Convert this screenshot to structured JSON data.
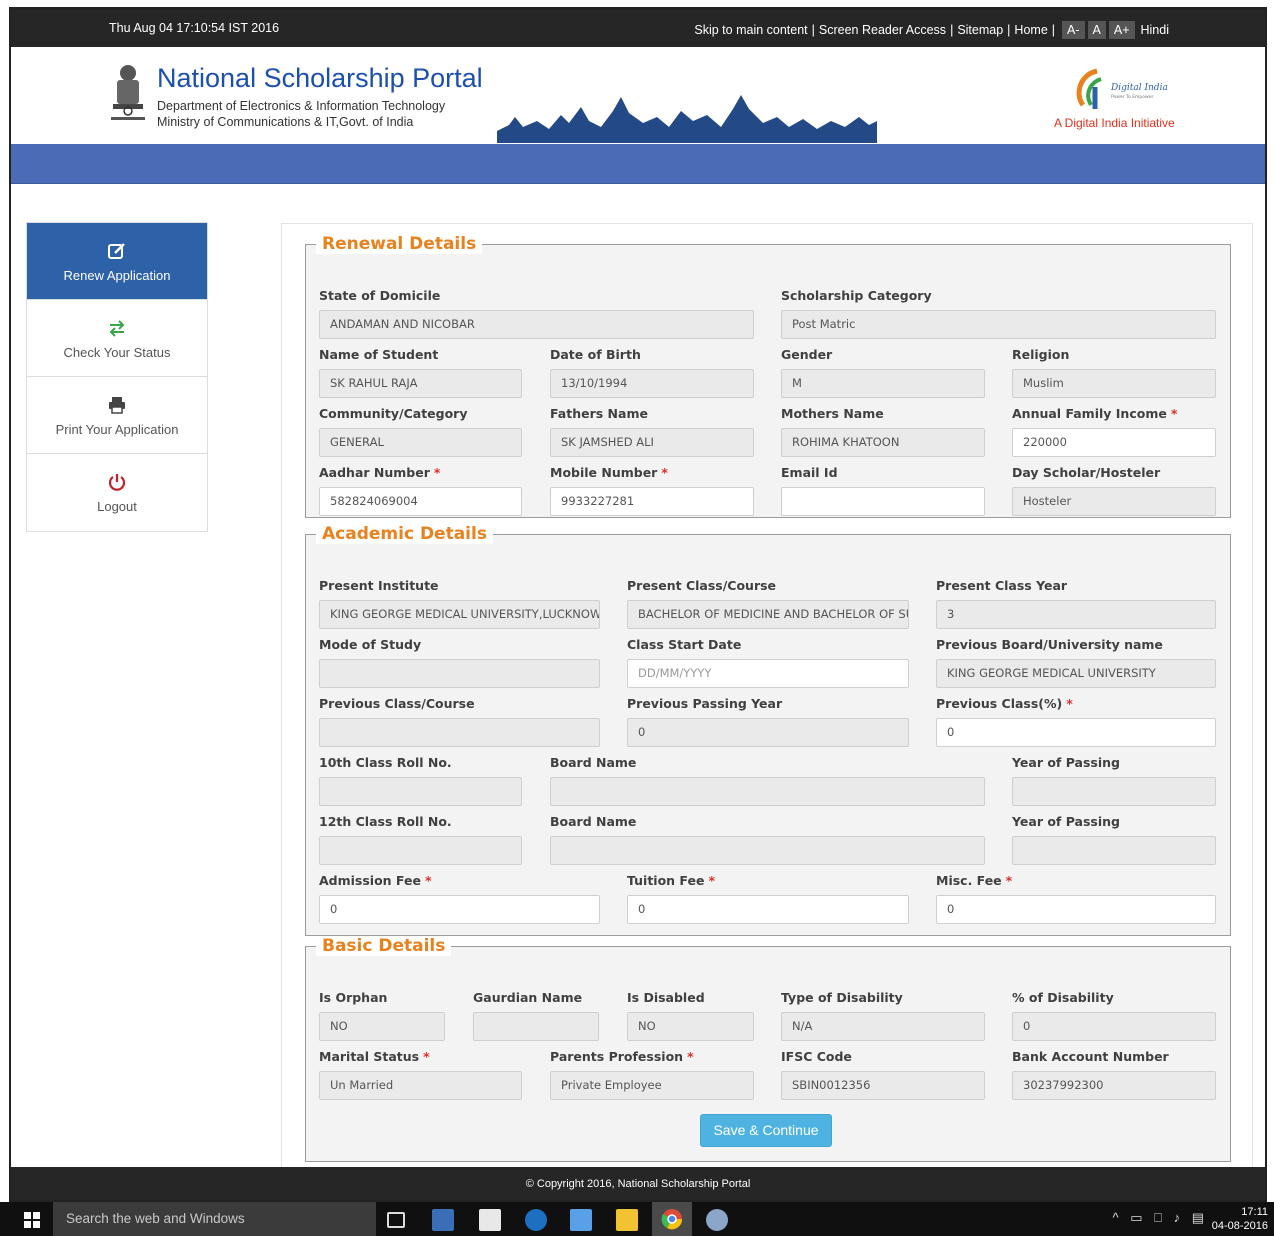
{
  "topbar": {
    "datetime": "Thu Aug 04 17:10:54 IST 2016",
    "links": {
      "skip": "Skip to main content",
      "screen_reader": "Screen Reader Access",
      "sitemap": "Sitemap",
      "home": "Home",
      "font_small": "A-",
      "font_normal": "A",
      "font_large": "A+",
      "hindi": "Hindi"
    },
    "separator": "|"
  },
  "header": {
    "title": "National Scholarship Portal",
    "dept_line1": "Department of Electronics & Information Technology",
    "dept_line2": "Ministry of Communications & IT,Govt. of India",
    "digital_india_logo_text": "Digital India",
    "digital_india_tagline": "Power To Empower",
    "digital_india_caption": "A Digital India Initiative"
  },
  "sidebar": {
    "items": [
      {
        "label": "Renew Application",
        "icon": "edit-icon",
        "active": true
      },
      {
        "label": "Check Your Status",
        "icon": "arrows-exchange-icon",
        "active": false
      },
      {
        "label": "Print Your Application",
        "icon": "printer-icon",
        "active": false
      },
      {
        "label": "Logout",
        "icon": "power-icon",
        "active": false
      }
    ]
  },
  "renewal": {
    "legend": "Renewal Details",
    "state_label": "State of Domicile",
    "state_value": "ANDAMAN AND NICOBAR",
    "scholarship_cat_label": "Scholarship Category",
    "scholarship_cat_value": "Post Matric",
    "name_label": "Name of Student",
    "name_value": "SK RAHUL RAJA",
    "dob_label": "Date of Birth",
    "dob_value": "13/10/1994",
    "gender_label": "Gender",
    "gender_value": "M",
    "religion_label": "Religion",
    "religion_value": "Muslim",
    "community_label": "Community/Category",
    "community_value": "GENERAL",
    "father_label": "Fathers Name",
    "father_value": "SK JAMSHED ALI",
    "mother_label": "Mothers Name",
    "mother_value": "ROHIMA KHATOON",
    "income_label": "Annual Family Income",
    "income_value": "220000",
    "aadhar_label": "Aadhar Number",
    "aadhar_value": "582824069004",
    "mobile_label": "Mobile Number",
    "mobile_value": "9933227281",
    "email_label": "Email Id",
    "email_value": "",
    "dayscholar_label": "Day Scholar/Hosteler",
    "dayscholar_value": "Hosteler"
  },
  "academic": {
    "legend": "Academic Details",
    "institute_label": "Present Institute",
    "institute_value": "KING GEORGE MEDICAL UNIVERSITY,LUCKNOW",
    "class_label": "Present Class/Course",
    "class_value": "BACHELOR OF MEDICINE AND BACHELOR OF SURGERY",
    "class_year_label": "Present Class Year",
    "class_year_value": "3",
    "mode_label": "Mode of Study",
    "mode_value": "",
    "start_date_label": "Class Start Date",
    "start_date_placeholder": "DD/MM/YYYY",
    "prev_board_label": "Previous Board/University name",
    "prev_board_value": "KING GEORGE MEDICAL UNIVERSITY",
    "prev_class_label": "Previous Class/Course",
    "prev_class_value": "",
    "prev_year_label": "Previous Passing Year",
    "prev_year_value": "0",
    "prev_pct_label": "Previous Class(%)",
    "prev_pct_value": "0",
    "roll10_label": "10th Class Roll No.",
    "roll10_value": "",
    "board10_label": "Board Name",
    "board10_value": "",
    "year10_label": "Year of Passing",
    "year10_value": "",
    "roll12_label": "12th Class Roll No.",
    "roll12_value": "",
    "board12_label": "Board Name",
    "board12_value": "",
    "year12_label": "Year of Passing",
    "year12_value": "",
    "admission_label": "Admission Fee",
    "admission_value": "0",
    "tuition_label": "Tuition Fee",
    "tuition_value": "0",
    "misc_label": "Misc. Fee",
    "misc_value": "0"
  },
  "basic": {
    "legend": "Basic Details",
    "orphan_label": "Is Orphan",
    "orphan_value": "NO",
    "guardian_label": "Gaurdian Name",
    "guardian_value": "",
    "disabled_label": "Is Disabled",
    "disabled_value": "NO",
    "disability_type_label": "Type of Disability",
    "disability_type_value": "N/A",
    "disability_pct_label": "% of Disability",
    "disability_pct_value": "0",
    "marital_label": "Marital Status",
    "marital_value": "Un Married",
    "parents_prof_label": "Parents Profession",
    "parents_prof_value": "Private Employee",
    "ifsc_label": "IFSC Code",
    "ifsc_value": "SBIN0012356",
    "bank_label": "Bank Account Number",
    "bank_value": "30237992300",
    "save_label": "Save & Continue"
  },
  "footer": {
    "copyright": "© Copyright 2016, National Scholarship Portal"
  },
  "taskbar": {
    "search_text": "Search the web and Windows",
    "time": "17:11",
    "date": "04-08-2016"
  },
  "colors": {
    "accent_orange": "#e8821e",
    "brand_blue": "#2d61a8",
    "band_blue": "#4a6bb5",
    "button_blue": "#4fb3e2",
    "required_red": "#d9302c"
  }
}
